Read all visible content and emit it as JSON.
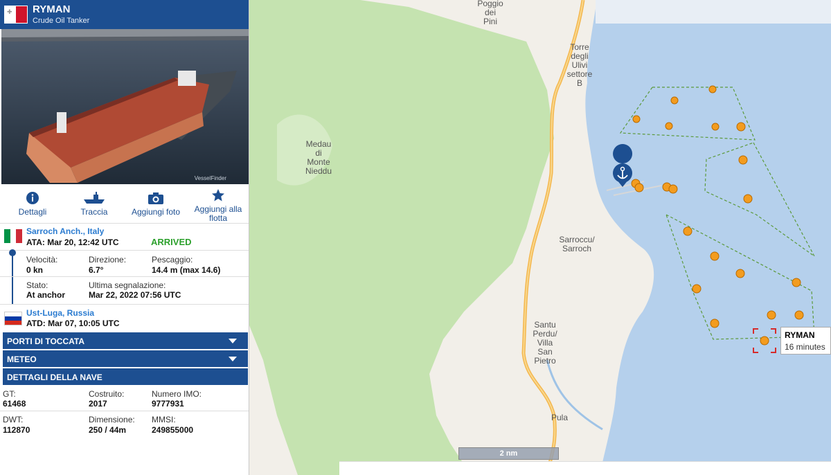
{
  "vessel": {
    "name": "RYMAN",
    "type": "Crude Oil Tanker",
    "flag_icon": "malta-flag-icon"
  },
  "actions": [
    {
      "label": "Dettagli",
      "icon": "info-icon"
    },
    {
      "label": "Traccia",
      "icon": "ship-icon"
    },
    {
      "label": "Aggiungi foto",
      "icon": "camera-icon"
    },
    {
      "label": "Aggiungi alla flotta",
      "icon": "star-icon"
    }
  ],
  "voyage": {
    "destination": {
      "port": "Sarroch Anch., Italy",
      "ata": "ATA: Mar 20, 12:42 UTC",
      "status": "ARRIVED",
      "flag_icon": "italy-flag-icon"
    },
    "speed": {
      "label": "Velocità:",
      "value": "0 kn"
    },
    "course": {
      "label": "Direzione:",
      "value": "6.7°"
    },
    "draught": {
      "label": "Pescaggio:",
      "value": "14.4 m (max 14.6)"
    },
    "state": {
      "label": "Stato:",
      "value": "At anchor"
    },
    "last_report": {
      "label": "Ultima segnalazione:",
      "value": "Mar 22, 2022 07:56 UTC"
    },
    "origin": {
      "port": "Ust-Luga, Russia",
      "atd": "ATD: Mar 07, 10:05 UTC",
      "flag_icon": "russia-flag-icon"
    }
  },
  "sections": {
    "ports": "PORTI DI TOCCATA",
    "weather": "METEO",
    "details": "DETTAGLI DELLA NAVE"
  },
  "details": {
    "gt": {
      "label": "GT:",
      "value": "61468"
    },
    "built": {
      "label": "Costruito:",
      "value": "2017"
    },
    "imo": {
      "label": "Numero IMO:",
      "value": "9777931"
    },
    "dwt": {
      "label": "DWT:",
      "value": "112870"
    },
    "size": {
      "label": "Dimensione:",
      "value": "250 / 44m"
    },
    "mmsi": {
      "label": "MMSI:",
      "value": "249855000"
    }
  },
  "photo": {
    "watermark": "VesselFinder"
  },
  "map": {
    "places": [
      "Poggio dei Pini",
      "Torre degli Ulivi settore B",
      "Medau di Monte Nieddu",
      "Sarroccu/ Sarroch",
      "Santu Perdu/ Villa San Pietro",
      "Pula"
    ],
    "scale": "2 nm",
    "tooltip": {
      "name": "RYMAN",
      "age": "16 minutes"
    },
    "colors": {
      "sea": "#b5d0ec",
      "land": "#f2efe9",
      "park": "#c5e3b0",
      "vessel": "#f39c1f",
      "anchor": "#1d4f91"
    }
  }
}
